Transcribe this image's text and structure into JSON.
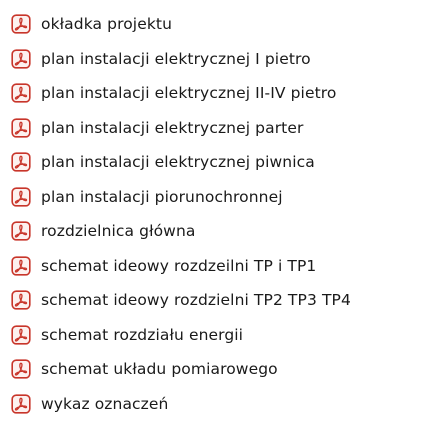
{
  "icon_name": "pdf-file-icon",
  "icon_color": "#c8352a",
  "files": [
    {
      "label": "okładka projektu"
    },
    {
      "label": "plan instalacji elektrycznej I pietro"
    },
    {
      "label": "plan instalacji elektrycznej II-IV pietro"
    },
    {
      "label": "plan instalacji elektrycznej parter"
    },
    {
      "label": "plan instalacji elektrycznej piwnica"
    },
    {
      "label": "plan instalacji piorunochronnej"
    },
    {
      "label": "rozdzielnica główna"
    },
    {
      "label": "schemat ideowy rozdzeilni TP i TP1"
    },
    {
      "label": "schemat ideowy rozdzielni TP2 TP3 TP4"
    },
    {
      "label": "schemat rozdziału energii"
    },
    {
      "label": "schemat układu pomiarowego"
    },
    {
      "label": "wykaz oznaczeń"
    }
  ]
}
